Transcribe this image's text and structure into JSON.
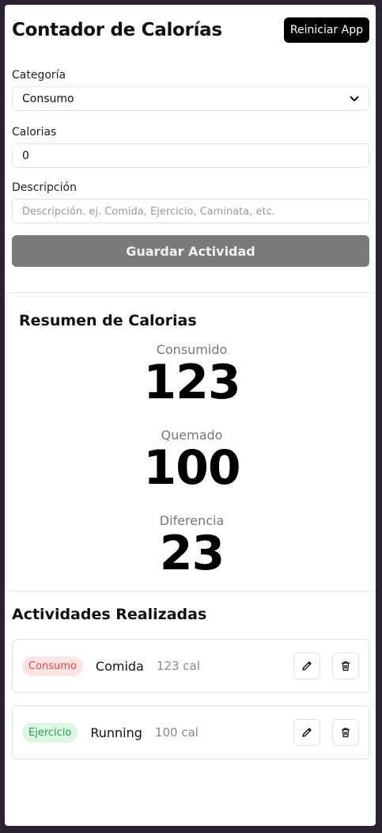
{
  "header": {
    "title": "Contador de Calorías",
    "reset_label": "Reiniciar App"
  },
  "form": {
    "category_label": "Categoría",
    "category_value": "Consumo",
    "calories_label": "Calorias",
    "calories_value": "0",
    "description_label": "Descripción",
    "description_placeholder": "Descripción. ej. Comida, Ejercicio, Caminata, etc.",
    "save_label": "Guardar Actividad"
  },
  "summary": {
    "title": "Resumen de Calorias",
    "consumed_label": "Consumido",
    "consumed_value": "123",
    "burned_label": "Quemado",
    "burned_value": "100",
    "diff_label": "Diferencia",
    "diff_value": "23"
  },
  "activities": {
    "title": "Actividades Realizadas",
    "items": [
      {
        "category": "Consumo",
        "name": "Comida",
        "calories": "123 cal",
        "color": "#d44444"
      },
      {
        "category": "Ejercicio",
        "name": "Running",
        "calories": "100 cal",
        "color": "#26a04c"
      }
    ]
  },
  "icons": {
    "edit": "pencil-icon",
    "delete": "trash-icon"
  }
}
